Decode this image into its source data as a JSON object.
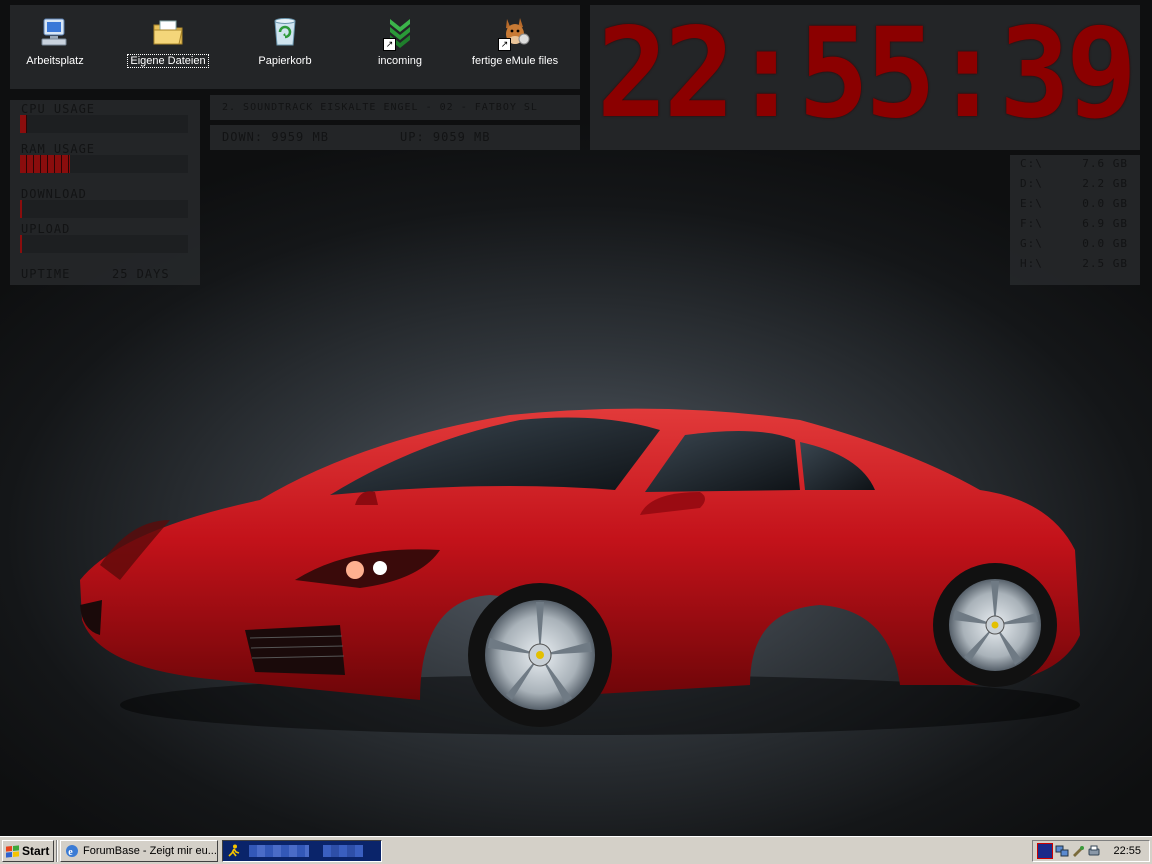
{
  "desktop_icons": [
    {
      "label": "Arbeitsplatz",
      "icon": "my-computer-icon",
      "selected": false,
      "shortcut": false
    },
    {
      "label": "Eigene Dateien",
      "icon": "my-documents-folder-icon",
      "selected": true,
      "shortcut": false
    },
    {
      "label": "Papierkorb",
      "icon": "recycle-bin-icon",
      "selected": false,
      "shortcut": false
    },
    {
      "label": "incoming",
      "icon": "green-download-arrow-icon",
      "selected": false,
      "shortcut": true
    },
    {
      "label": "fertige eMule files",
      "icon": "emule-mule-icon",
      "selected": false,
      "shortcut": true
    }
  ],
  "system_monitor": {
    "meters": [
      {
        "label": "CPU USAGE",
        "level": 0.04
      },
      {
        "label": "RAM USAGE",
        "level": 0.3
      },
      {
        "label": "DOWNLOAD",
        "level": 0.01
      },
      {
        "label": "UPLOAD",
        "level": 0.01
      }
    ],
    "uptime_label": "UPTIME",
    "uptime_value": "25 DAYS"
  },
  "now_playing": "2. SOUNDTRACK EISKALTE ENGEL - 02 - FATBOY SL",
  "traffic": {
    "down": "DOWN: 9959 MB",
    "up": "UP: 9059 MB"
  },
  "clock": "22:55:39",
  "drives": [
    {
      "drive": "C:\\",
      "free": "7.6 GB"
    },
    {
      "drive": "D:\\",
      "free": "2.2 GB"
    },
    {
      "drive": "E:\\",
      "free": "0.0 GB"
    },
    {
      "drive": "F:\\",
      "free": "6.9 GB"
    },
    {
      "drive": "G:\\",
      "free": "0.0 GB"
    },
    {
      "drive": "H:\\",
      "free": "2.5 GB"
    }
  ],
  "taskbar": {
    "start_label": "Start",
    "tasks": [
      {
        "label": "ForumBase - Zeigt mir eu...",
        "icon": "internet-explorer-icon",
        "active": false
      },
      {
        "label": "",
        "icon": "icq-running-man-icon",
        "active": true
      }
    ],
    "tray_icons": [
      "antivirus-tray-icon",
      "network-tray-icon",
      "usb-device-tray-icon",
      "printer-tray-icon"
    ],
    "time": "22:55"
  },
  "colors": {
    "lcd_red": "#8b0000",
    "panel_bg": "#26282a",
    "taskbar_bg": "#d4d0c8",
    "active_task": "#0a246a",
    "car_red": "#c3121a"
  }
}
